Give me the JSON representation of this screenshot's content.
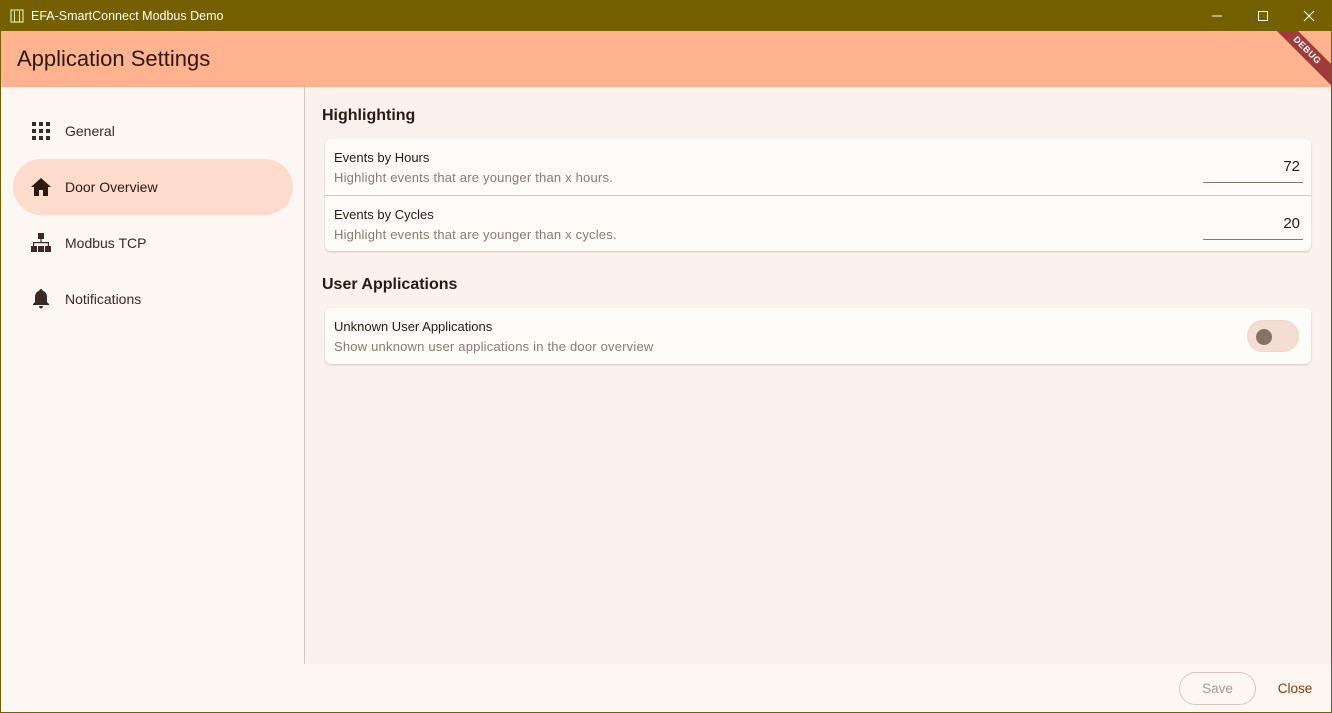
{
  "window": {
    "title": "EFA-SmartConnect Modbus Demo",
    "icon": "door-app-icon"
  },
  "appbar": {
    "title": "Application Settings",
    "debug_banner": "DEBUG"
  },
  "sidebar": {
    "items": [
      {
        "label": "General",
        "icon": "grid-icon",
        "active": false
      },
      {
        "label": "Door Overview",
        "icon": "home-icon",
        "active": true
      },
      {
        "label": "Modbus TCP",
        "icon": "network-icon",
        "active": false
      },
      {
        "label": "Notifications",
        "icon": "bell-icon",
        "active": false
      }
    ]
  },
  "sections": {
    "highlighting": {
      "title": "Highlighting",
      "rows": [
        {
          "title": "Events by Hours",
          "subtitle": "Highlight events that are younger than x hours.",
          "value": "72"
        },
        {
          "title": "Events by Cycles",
          "subtitle": "Highlight events that are younger than x cycles.",
          "value": "20"
        }
      ]
    },
    "user_applications": {
      "title": "User Applications",
      "rows": [
        {
          "title": "Unknown User Applications",
          "subtitle": "Show unknown user applications in the door overview",
          "enabled": false
        }
      ]
    }
  },
  "footer": {
    "save_label": "Save",
    "close_label": "Close"
  },
  "colors": {
    "titlebar": "#746000",
    "appbar": "#ffb48f",
    "active_nav": "#ffdbcb",
    "debug_banner": "#a13b3b",
    "close_text": "#8a3b00"
  }
}
